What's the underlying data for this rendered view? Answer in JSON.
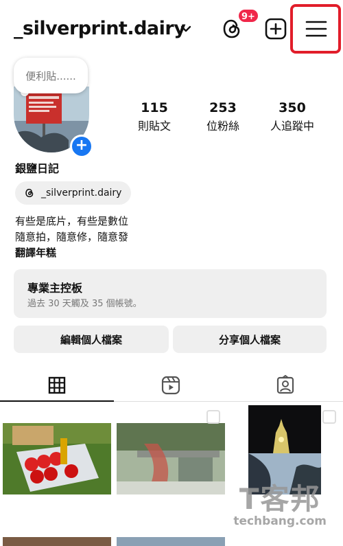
{
  "header": {
    "username": "_silverprint.dairy",
    "threads_badge": "9+"
  },
  "note": {
    "text": "便利貼......"
  },
  "stats": [
    {
      "value": "115",
      "label": "則貼文"
    },
    {
      "value": "253",
      "label": "位粉絲"
    },
    {
      "value": "350",
      "label": "人追蹤中"
    }
  ],
  "profile": {
    "display_name": "銀鹽日記",
    "threads_handle": "_silverprint.dairy",
    "bio_line1": "有些是底片，有些是數位",
    "bio_line2": "隨意拍，隨意修，隨意發",
    "bio_line3": "翻譯年糕"
  },
  "dashboard": {
    "title": "專業主控板",
    "subtitle": "過去 30 天觸及 35 個帳號。"
  },
  "actions": {
    "edit_label": "編輯個人檔案",
    "share_label": "分享個人檔案"
  },
  "tabs": [
    "grid-icon",
    "reels-icon",
    "tagged-icon"
  ],
  "watermark": {
    "logo": "T客邦",
    "text": "techbang.com"
  },
  "colors": {
    "highlight": "#e11d2a",
    "badge": "#f0274a",
    "avatar_plus": "#1877f2"
  }
}
